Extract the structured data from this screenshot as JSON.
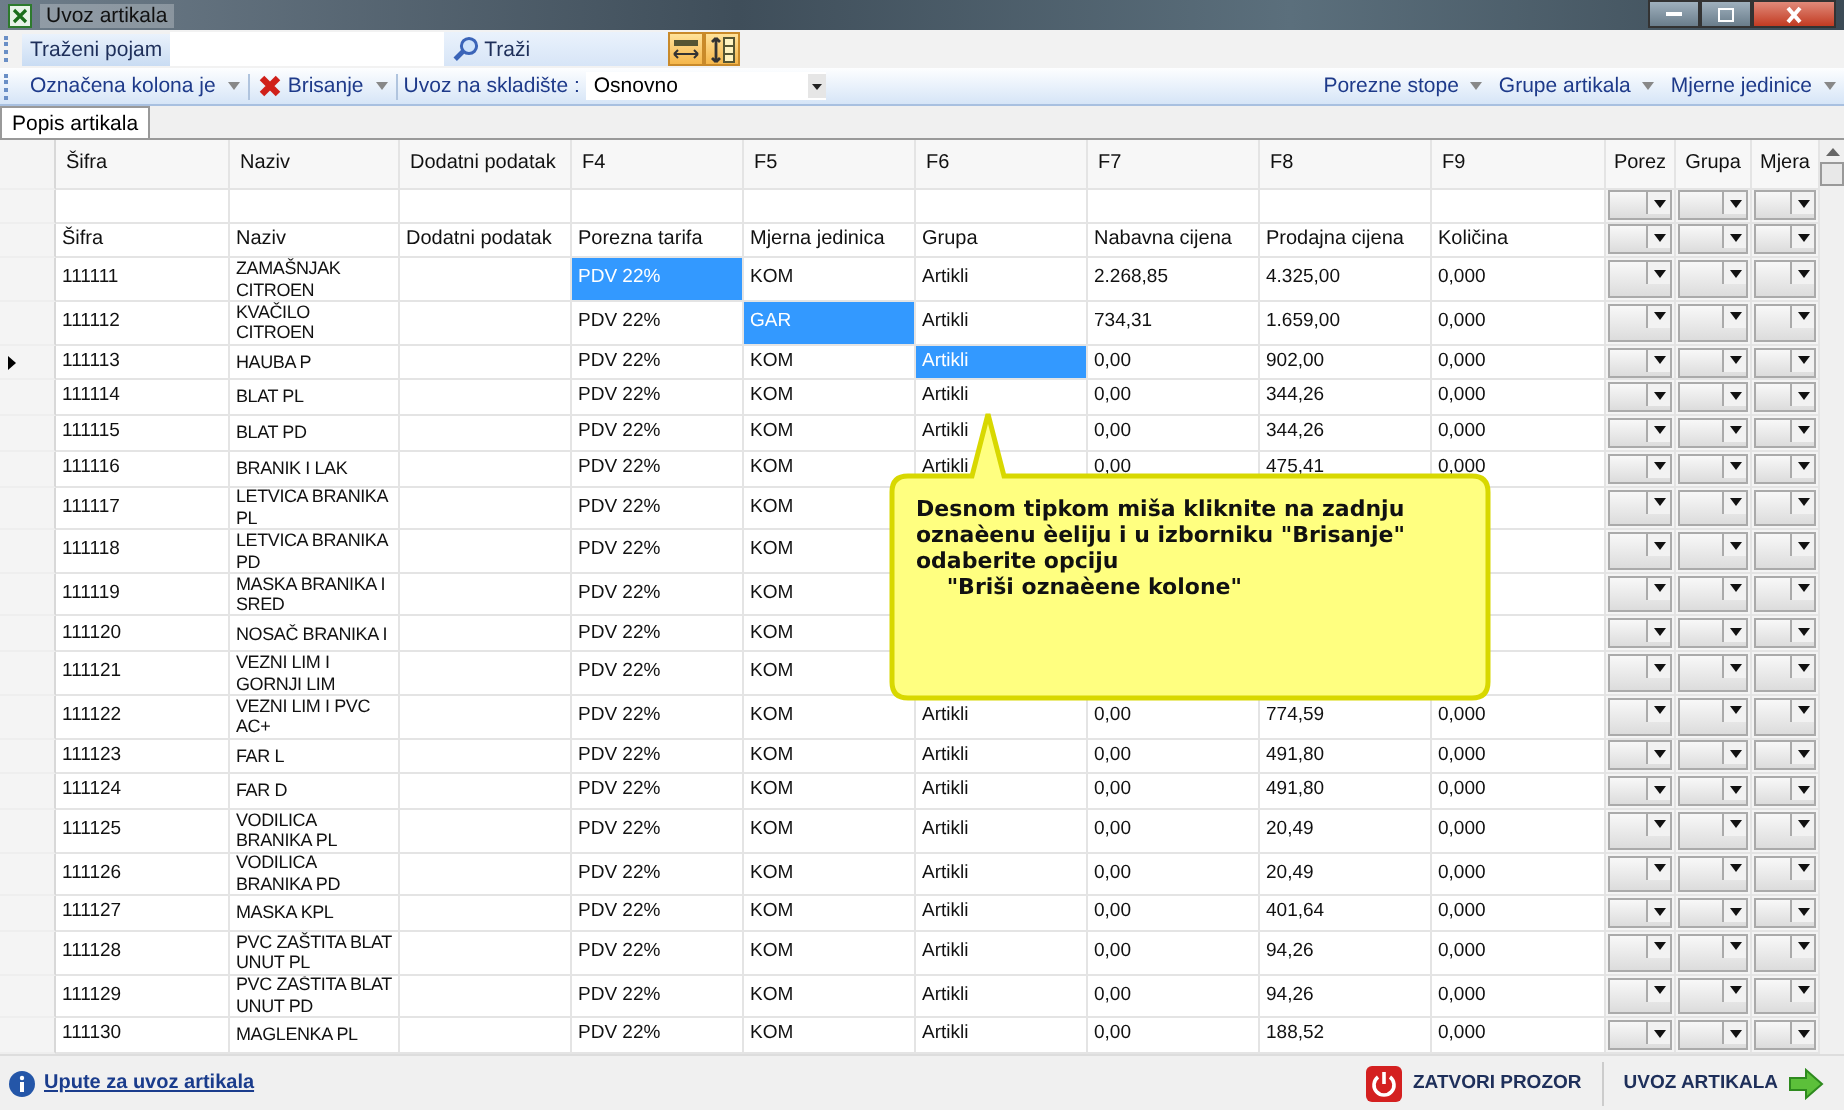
{
  "window": {
    "title": "Uvoz artikala"
  },
  "search_toolbar": {
    "label": "Traženi pojam",
    "search_button": "Traži"
  },
  "action_toolbar": {
    "left_menus": [
      "Označena kolona je",
      "Brisanje"
    ],
    "warehouse_label": "Uvoz na skladište :",
    "warehouse_value": "Osnovno",
    "right_menus": [
      "Porezne stope",
      "Grupe artikala",
      "Mjerne jedinice"
    ]
  },
  "tabs": [
    {
      "label": "Popis artikala",
      "selected": true
    }
  ],
  "table": {
    "columns": [
      "Šifra",
      "Naziv",
      "Dodatni podatak",
      "F4",
      "F5",
      "F6",
      "F7",
      "F8",
      "F9",
      "Porez",
      "Grupa",
      "Mjera"
    ],
    "mapping_row": [
      "Šifra",
      "Naziv",
      "Dodatni podatak",
      "Porezna tarifa",
      "Mjerna jedinica",
      "Grupa",
      "Nabavna cijena",
      "Prodajna cijena",
      "Količina"
    ],
    "rows": [
      {
        "current": false,
        "cells": [
          {
            "text": "111111",
            "selected": false
          },
          {
            "text": "ZAMAŠNJAK CITROEN",
            "selected": false
          },
          {
            "text": "",
            "selected": false
          },
          {
            "text": "PDV 22%",
            "selected": true
          },
          {
            "text": "KOM",
            "selected": false
          },
          {
            "text": "Artikli",
            "selected": false
          },
          {
            "text": "2.268,85",
            "selected": false
          },
          {
            "text": "4.325,00",
            "selected": false
          },
          {
            "text": "0,000",
            "selected": false
          }
        ]
      },
      {
        "current": false,
        "cells": [
          {
            "text": "111112",
            "selected": false
          },
          {
            "text": "KVAČILO CITROEN",
            "selected": false
          },
          {
            "text": "",
            "selected": false
          },
          {
            "text": "PDV 22%",
            "selected": false
          },
          {
            "text": "GAR",
            "selected": true
          },
          {
            "text": "Artikli",
            "selected": false
          },
          {
            "text": "734,31",
            "selected": false
          },
          {
            "text": "1.659,00",
            "selected": false
          },
          {
            "text": "0,000",
            "selected": false
          }
        ]
      },
      {
        "current": true,
        "cells": [
          {
            "text": "111113",
            "selected": false
          },
          {
            "text": "HAUBA P",
            "selected": false
          },
          {
            "text": "",
            "selected": false
          },
          {
            "text": "PDV 22%",
            "selected": false
          },
          {
            "text": "KOM",
            "selected": false
          },
          {
            "text": "Artikli",
            "selected": true
          },
          {
            "text": "0,00",
            "selected": false
          },
          {
            "text": "902,00",
            "selected": false
          },
          {
            "text": "0,000",
            "selected": false
          }
        ]
      },
      {
        "current": false,
        "cells": [
          {
            "text": "111114",
            "selected": false
          },
          {
            "text": "BLAT PL",
            "selected": false
          },
          {
            "text": "",
            "selected": false
          },
          {
            "text": "PDV 22%",
            "selected": false
          },
          {
            "text": "KOM",
            "selected": false
          },
          {
            "text": "Artikli",
            "selected": false
          },
          {
            "text": "0,00",
            "selected": false
          },
          {
            "text": "344,26",
            "selected": false
          },
          {
            "text": "0,000",
            "selected": false
          }
        ]
      },
      {
        "current": false,
        "cells": [
          {
            "text": "111115",
            "selected": false
          },
          {
            "text": "BLAT PD",
            "selected": false
          },
          {
            "text": "",
            "selected": false
          },
          {
            "text": "PDV 22%",
            "selected": false
          },
          {
            "text": "KOM",
            "selected": false
          },
          {
            "text": "Artikli",
            "selected": false
          },
          {
            "text": "0,00",
            "selected": false
          },
          {
            "text": "344,26",
            "selected": false
          },
          {
            "text": "0,000",
            "selected": false
          }
        ]
      },
      {
        "current": false,
        "cells": [
          {
            "text": "111116",
            "selected": false
          },
          {
            "text": "BRANIK I LAK",
            "selected": false
          },
          {
            "text": "",
            "selected": false
          },
          {
            "text": "PDV 22%",
            "selected": false
          },
          {
            "text": "KOM",
            "selected": false
          },
          {
            "text": "Artikli",
            "selected": false
          },
          {
            "text": "0,00",
            "selected": false
          },
          {
            "text": "475,41",
            "selected": false
          },
          {
            "text": "0,000",
            "selected": false
          }
        ]
      },
      {
        "current": false,
        "cells": [
          {
            "text": "111117",
            "selected": false
          },
          {
            "text": "LETVICA BRANIKA PL",
            "selected": false
          },
          {
            "text": "",
            "selected": false
          },
          {
            "text": "PDV 22%",
            "selected": false
          },
          {
            "text": "KOM",
            "selected": false
          },
          null,
          null,
          null,
          null
        ]
      },
      {
        "current": false,
        "cells": [
          {
            "text": "111118",
            "selected": false
          },
          {
            "text": "LETVICA BRANIKA PD",
            "selected": false
          },
          {
            "text": "",
            "selected": false
          },
          {
            "text": "PDV 22%",
            "selected": false
          },
          {
            "text": "KOM",
            "selected": false
          },
          null,
          null,
          null,
          null
        ]
      },
      {
        "current": false,
        "cells": [
          {
            "text": "111119",
            "selected": false
          },
          {
            "text": "MASKA BRANIKA I SRED",
            "selected": false
          },
          {
            "text": "",
            "selected": false
          },
          {
            "text": "PDV 22%",
            "selected": false
          },
          {
            "text": "KOM",
            "selected": false
          },
          null,
          null,
          null,
          null
        ]
      },
      {
        "current": false,
        "cells": [
          {
            "text": "111120",
            "selected": false
          },
          {
            "text": "NOSAČ BRANIKA I",
            "selected": false
          },
          {
            "text": "",
            "selected": false
          },
          {
            "text": "PDV 22%",
            "selected": false
          },
          {
            "text": "KOM",
            "selected": false
          },
          null,
          null,
          null,
          null
        ]
      },
      {
        "current": false,
        "cells": [
          {
            "text": "111121",
            "selected": false
          },
          {
            "text": "VEZNI LIM I GORNJI LIM",
            "selected": false
          },
          {
            "text": "",
            "selected": false
          },
          {
            "text": "PDV 22%",
            "selected": false
          },
          {
            "text": "KOM",
            "selected": false
          },
          null,
          null,
          null,
          null
        ]
      },
      {
        "current": false,
        "cells": [
          {
            "text": "111122",
            "selected": false
          },
          {
            "text": "VEZNI LIM I PVC AC+",
            "selected": false
          },
          {
            "text": "",
            "selected": false
          },
          {
            "text": "PDV 22%",
            "selected": false
          },
          {
            "text": "KOM",
            "selected": false
          },
          {
            "text": "Artikli",
            "selected": false
          },
          {
            "text": "0,00",
            "selected": false
          },
          {
            "text": "774,59",
            "selected": false
          },
          {
            "text": "0,000",
            "selected": false
          }
        ]
      },
      {
        "current": false,
        "cells": [
          {
            "text": "111123",
            "selected": false
          },
          {
            "text": "FAR L",
            "selected": false
          },
          {
            "text": "",
            "selected": false
          },
          {
            "text": "PDV 22%",
            "selected": false
          },
          {
            "text": "KOM",
            "selected": false
          },
          {
            "text": "Artikli",
            "selected": false
          },
          {
            "text": "0,00",
            "selected": false
          },
          {
            "text": "491,80",
            "selected": false
          },
          {
            "text": "0,000",
            "selected": false
          }
        ]
      },
      {
        "current": false,
        "cells": [
          {
            "text": "111124",
            "selected": false
          },
          {
            "text": "FAR D",
            "selected": false
          },
          {
            "text": "",
            "selected": false
          },
          {
            "text": "PDV 22%",
            "selected": false
          },
          {
            "text": "KOM",
            "selected": false
          },
          {
            "text": "Artikli",
            "selected": false
          },
          {
            "text": "0,00",
            "selected": false
          },
          {
            "text": "491,80",
            "selected": false
          },
          {
            "text": "0,000",
            "selected": false
          }
        ]
      },
      {
        "current": false,
        "cells": [
          {
            "text": "111125",
            "selected": false
          },
          {
            "text": "VODILICA BRANIKA PL",
            "selected": false
          },
          {
            "text": "",
            "selected": false
          },
          {
            "text": "PDV 22%",
            "selected": false
          },
          {
            "text": "KOM",
            "selected": false
          },
          {
            "text": "Artikli",
            "selected": false
          },
          {
            "text": "0,00",
            "selected": false
          },
          {
            "text": "20,49",
            "selected": false
          },
          {
            "text": "0,000",
            "selected": false
          }
        ]
      },
      {
        "current": false,
        "cells": [
          {
            "text": "111126",
            "selected": false
          },
          {
            "text": "VODILICA BRANIKA PD",
            "selected": false
          },
          {
            "text": "",
            "selected": false
          },
          {
            "text": "PDV 22%",
            "selected": false
          },
          {
            "text": "KOM",
            "selected": false
          },
          {
            "text": "Artikli",
            "selected": false
          },
          {
            "text": "0,00",
            "selected": false
          },
          {
            "text": "20,49",
            "selected": false
          },
          {
            "text": "0,000",
            "selected": false
          }
        ]
      },
      {
        "current": false,
        "cells": [
          {
            "text": "111127",
            "selected": false
          },
          {
            "text": "MASKA KPL",
            "selected": false
          },
          {
            "text": "",
            "selected": false
          },
          {
            "text": "PDV 22%",
            "selected": false
          },
          {
            "text": "KOM",
            "selected": false
          },
          {
            "text": "Artikli",
            "selected": false
          },
          {
            "text": "0,00",
            "selected": false
          },
          {
            "text": "401,64",
            "selected": false
          },
          {
            "text": "0,000",
            "selected": false
          }
        ]
      },
      {
        "current": false,
        "cells": [
          {
            "text": "111128",
            "selected": false
          },
          {
            "text": "PVC ZAŠTITA BLAT UNUT PL",
            "selected": false
          },
          {
            "text": "",
            "selected": false
          },
          {
            "text": "PDV 22%",
            "selected": false
          },
          {
            "text": "KOM",
            "selected": false
          },
          {
            "text": "Artikli",
            "selected": false
          },
          {
            "text": "0,00",
            "selected": false
          },
          {
            "text": "94,26",
            "selected": false
          },
          {
            "text": "0,000",
            "selected": false
          }
        ]
      },
      {
        "current": false,
        "cells": [
          {
            "text": "111129",
            "selected": false
          },
          {
            "text": "PVC ZAŠTITA BLAT UNUT PD",
            "selected": false
          },
          {
            "text": "",
            "selected": false
          },
          {
            "text": "PDV 22%",
            "selected": false
          },
          {
            "text": "KOM",
            "selected": false
          },
          {
            "text": "Artikli",
            "selected": false
          },
          {
            "text": "0,00",
            "selected": false
          },
          {
            "text": "94,26",
            "selected": false
          },
          {
            "text": "0,000",
            "selected": false
          }
        ]
      },
      {
        "current": false,
        "cells": [
          {
            "text": "111130",
            "selected": false
          },
          {
            "text": "MAGLENKA PL",
            "selected": false
          },
          {
            "text": "",
            "selected": false
          },
          {
            "text": "PDV 22%",
            "selected": false
          },
          {
            "text": "KOM",
            "selected": false
          },
          {
            "text": "Artikli",
            "selected": false
          },
          {
            "text": "0,00",
            "selected": false
          },
          {
            "text": "188,52",
            "selected": false
          },
          {
            "text": "0,000",
            "selected": false
          }
        ]
      }
    ]
  },
  "callout": {
    "text": "Desnom tipkom miša kliknite na zadnju\noznaèenu èeliju i u izborniku \"Brisanje\"\nodaberite opciju\n    \"Briši oznaèene kolone\""
  },
  "footer": {
    "help_link": "Upute za uvoz artikala",
    "buttons": [
      "ZATVORI PROZOR",
      "UVOZ ARTIKALA"
    ]
  }
}
